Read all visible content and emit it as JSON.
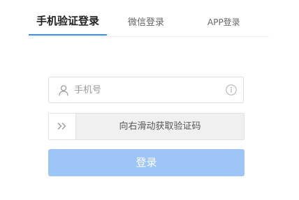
{
  "tabs": {
    "phone_login": "手机验证登录",
    "wechat_login": "微信登录",
    "app_login": "APP登录"
  },
  "phone_field": {
    "placeholder": "手机号",
    "value": "",
    "icon": "user-icon",
    "help_icon": "info-icon"
  },
  "slider": {
    "handle_icon": "double-chevron-right-icon",
    "text": "向右滑动获取验证码"
  },
  "login_button": {
    "label": "登录"
  },
  "colors": {
    "accent": "#3b8cff",
    "button_disabled": "#9ec5f7",
    "border": "#dcdcdc",
    "slider_bg": "#f0f0f0"
  }
}
